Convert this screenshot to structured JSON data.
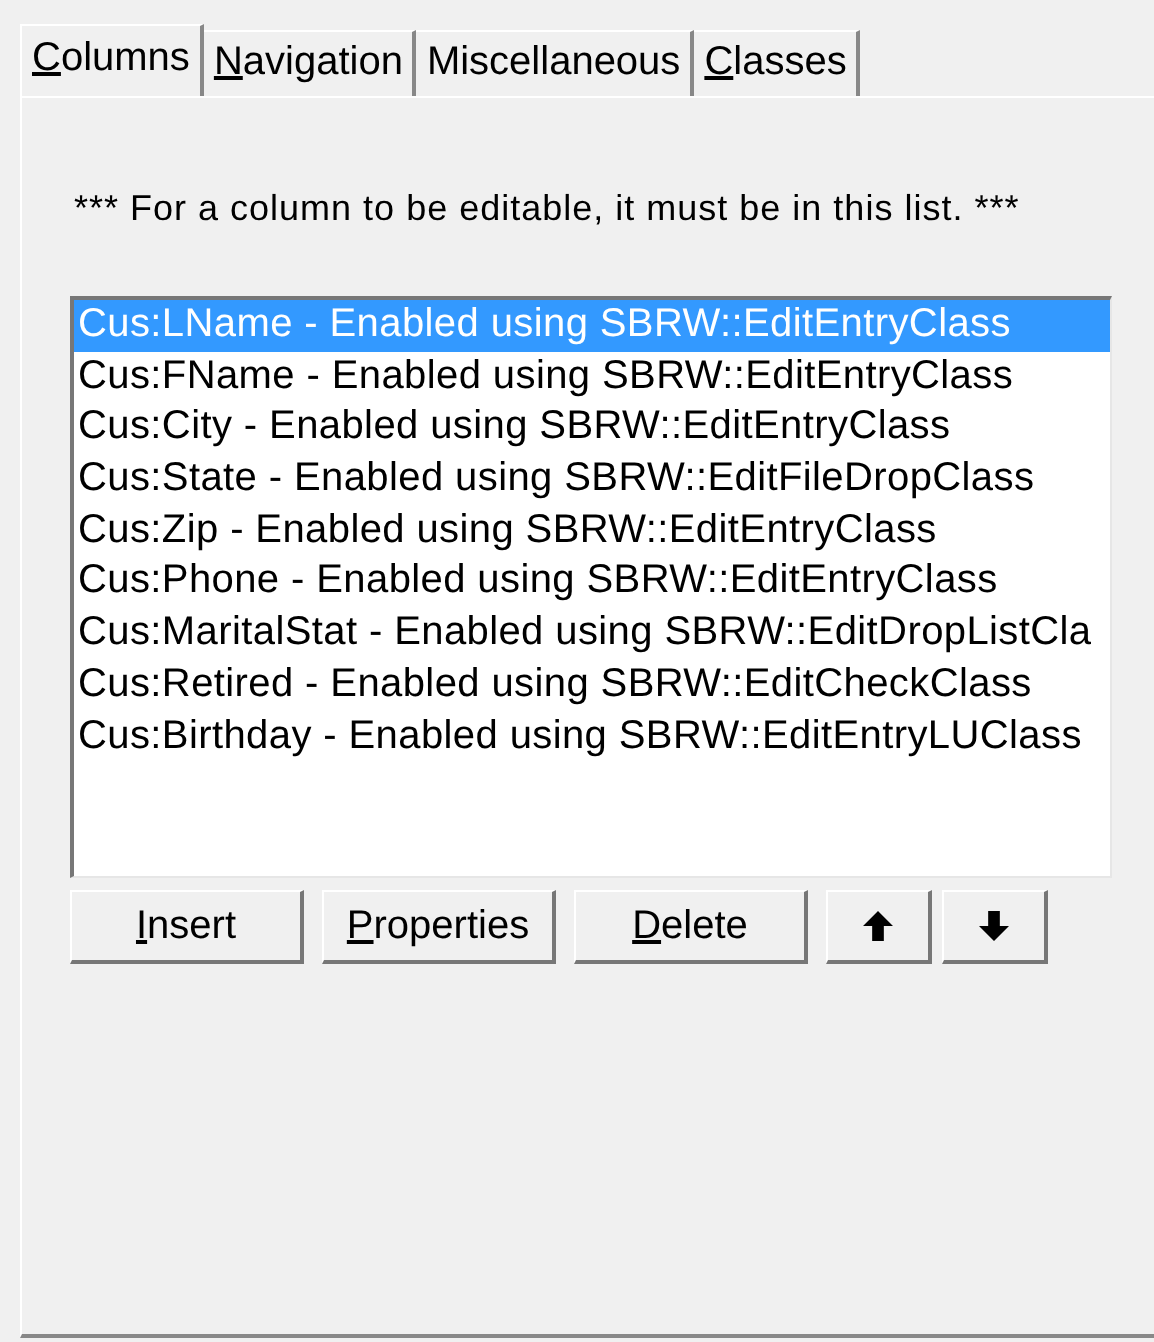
{
  "tabs": [
    {
      "label": "Columns",
      "first_letter_underlined": true,
      "selected": true
    },
    {
      "label": "Navigation",
      "first_letter_underlined": true,
      "selected": false
    },
    {
      "label": "Miscellaneous",
      "first_letter_underlined": false,
      "selected": false
    },
    {
      "label": "Classes",
      "first_letter_underlined": true,
      "selected": false
    }
  ],
  "note": "*** For a column to be editable, it must be in this list. ***",
  "list_items": [
    {
      "text": "Cus:LName - Enabled using SBRW::EditEntryClass",
      "selected": true
    },
    {
      "text": "Cus:FName - Enabled using SBRW::EditEntryClass",
      "selected": false
    },
    {
      "text": "Cus:City - Enabled using SBRW::EditEntryClass",
      "selected": false
    },
    {
      "text": "Cus:State - Enabled using SBRW::EditFileDropClass",
      "selected": false
    },
    {
      "text": "Cus:Zip - Enabled using SBRW::EditEntryClass",
      "selected": false
    },
    {
      "text": "Cus:Phone - Enabled using SBRW::EditEntryClass",
      "selected": false
    },
    {
      "text": "Cus:MaritalStat - Enabled using SBRW::EditDropListCla",
      "selected": false
    },
    {
      "text": "Cus:Retired - Enabled using SBRW::EditCheckClass",
      "selected": false
    },
    {
      "text": "Cus:Birthday - Enabled using SBRW::EditEntryLUClass",
      "selected": false
    }
  ],
  "buttons": [
    {
      "kind": "text",
      "label": "Insert",
      "first_letter_underlined": true
    },
    {
      "kind": "text",
      "label": "Properties",
      "first_letter_underlined": true
    },
    {
      "kind": "text",
      "label": "Delete",
      "first_letter_underlined": true
    },
    {
      "kind": "up"
    },
    {
      "kind": "down"
    }
  ]
}
